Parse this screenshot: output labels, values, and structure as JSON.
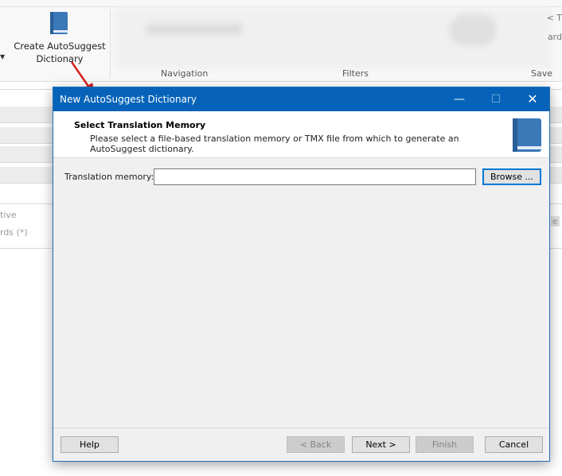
{
  "ribbon": {
    "create_button_line1": "Create AutoSuggest",
    "create_button_line2": "Dictionary",
    "group_navigation": "Navigation",
    "group_filters": "Filters",
    "group_save": "Save",
    "right_clip_1": "< T",
    "right_clip_2": "ard"
  },
  "background": {
    "row_text_1": "tive",
    "row_text_2": "rds (*)",
    "right_button_text": "e"
  },
  "dialog": {
    "title": "New AutoSuggest Dictionary",
    "minimize_glyph": "—",
    "maximize_glyph": "☐",
    "close_glyph": "✕",
    "header_title": "Select Translation Memory",
    "header_description": "Please select a file-based translation memory or TMX file from which to generate an AutoSuggest dictionary.",
    "translation_memory_label": "Translation memory:",
    "translation_memory_value": "",
    "browse_label": "Browse ...",
    "help_label": "Help",
    "back_label": "< Back",
    "next_label": "Next >",
    "finish_label": "Finish",
    "cancel_label": "Cancel"
  },
  "colors": {
    "titlebar": "#0663b9",
    "book_icon": "#3a78b8",
    "annotation_arrow": "#d42020"
  },
  "icons": [
    "book-icon",
    "minimize-icon",
    "maximize-icon",
    "close-icon",
    "arrow-annotation"
  ]
}
